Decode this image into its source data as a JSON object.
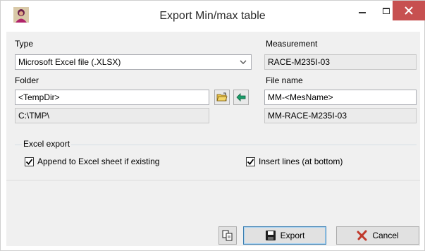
{
  "window": {
    "title": "Export Min/max table"
  },
  "type": {
    "label": "Type",
    "value": "Microsoft Excel file (.XLSX)"
  },
  "measurement": {
    "label": "Measurement",
    "value": "RACE-M235I-03"
  },
  "folder": {
    "label": "Folder",
    "value": "<TempDir>",
    "resolved": "C:\\TMP\\"
  },
  "file_name": {
    "label": "File name",
    "value": "MM-<MesName>",
    "resolved": "MM-RACE-M235I-03"
  },
  "excel_export": {
    "label": "Excel export",
    "append_label": "Append to Excel sheet if existing",
    "append_checked": true,
    "insert_label": "Insert lines (at bottom)",
    "insert_checked": true
  },
  "buttons": {
    "export_label": "Export",
    "cancel_label": "Cancel"
  },
  "colors": {
    "close_button": "#c75050",
    "cancel_icon": "#c0392b",
    "arrow_icon": "#1a9e6a"
  }
}
